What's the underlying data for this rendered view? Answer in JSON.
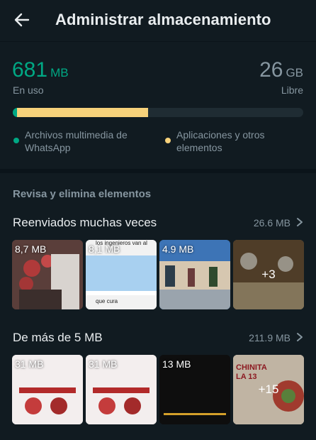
{
  "header": {
    "title": "Administrar almacenamiento",
    "back_icon": "arrow-back-icon"
  },
  "storage": {
    "used_value": "681",
    "used_unit": "MB",
    "used_label": "En uso",
    "free_value": "26",
    "free_unit": "GB",
    "free_label": "Libre",
    "bar": {
      "whatsapp_media_fraction": 0.015,
      "apps_fraction": 0.45,
      "whatsapp_color": "#00a884",
      "apps_color": "#f7d27b",
      "track_color": "#1f2c33"
    },
    "legend": [
      {
        "label": "Archivos multimedia de WhatsApp",
        "color": "#00a884"
      },
      {
        "label": "Aplicaciones y otros elementos",
        "color": "#f7d27b"
      }
    ]
  },
  "review": {
    "header": "Revisa y elimina elementos",
    "forwarded": {
      "title": "Reenviados muchas veces",
      "size": "26.6 MB",
      "thumbs": [
        {
          "label": "8,7 MB"
        },
        {
          "label": "8,1 MB",
          "caption_top": "los ingenieros van al",
          "caption_bottom": "que cura"
        },
        {
          "label": "4.9 MB"
        },
        {
          "label": "+3"
        }
      ]
    },
    "large": {
      "title": "De más de 5 MB",
      "size": "211.9 MB",
      "thumbs": [
        {
          "label": "31 MB"
        },
        {
          "label": "31 MB"
        },
        {
          "label": "13 MB"
        },
        {
          "label": "+15",
          "caption": "CHINITA LA 13"
        }
      ]
    }
  }
}
